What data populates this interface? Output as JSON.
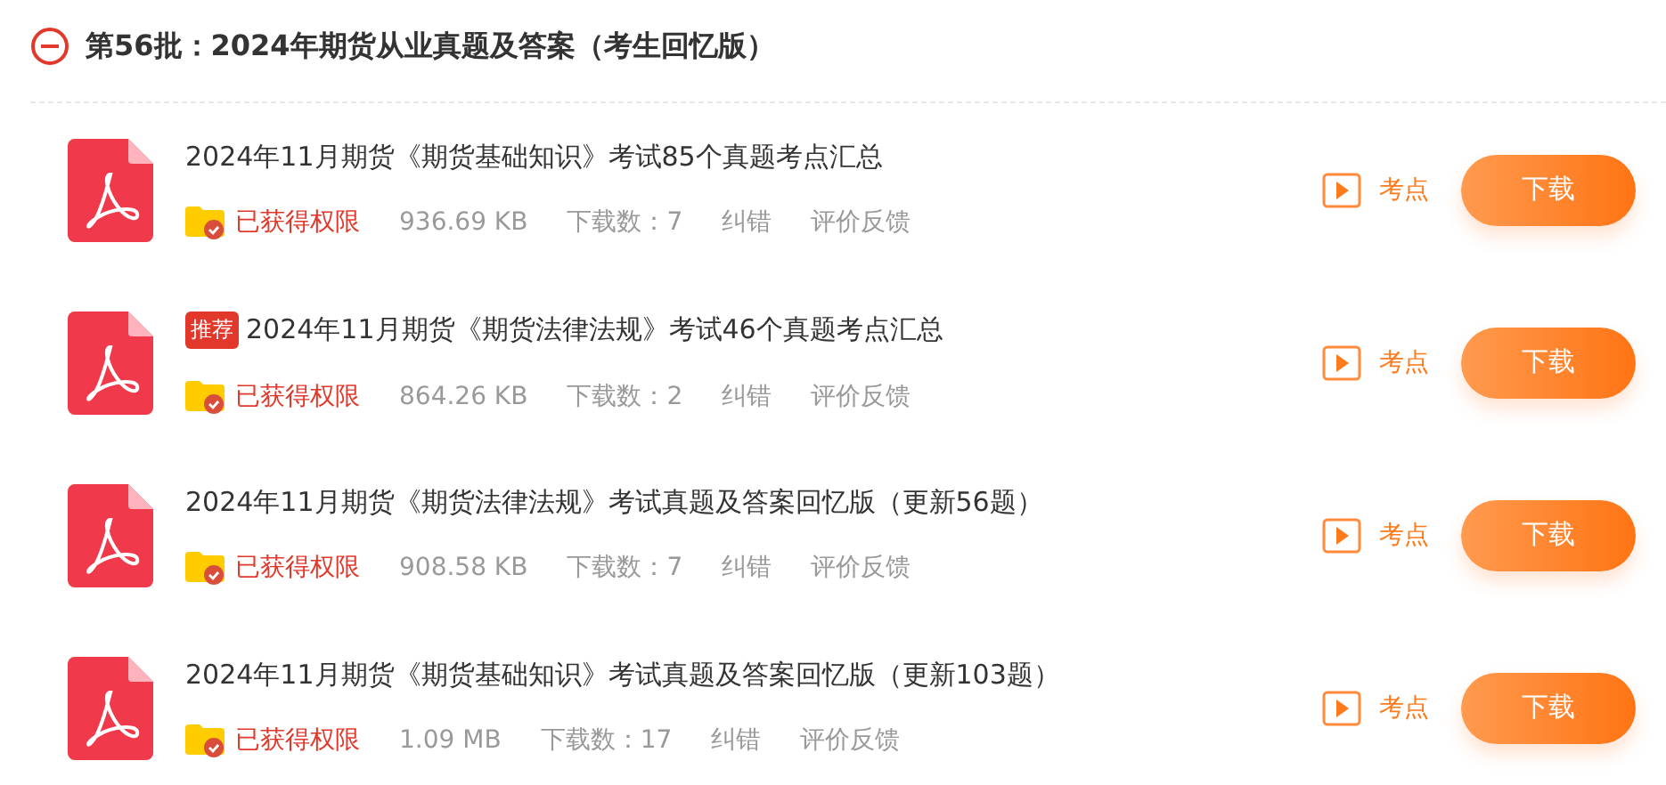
{
  "section": {
    "title": "第56批：2024年期货从业真题及答案（考生回忆版）",
    "expanded": true
  },
  "items": [
    {
      "title": "2024年11月期货《期货基础知识》考试85个真题考点汇总",
      "permission": "已获得权限",
      "size": "936.69 KB",
      "downloads": "下载数：7",
      "report": "纠错",
      "feedback": "评价反馈",
      "points": "考点",
      "download": "下载"
    },
    {
      "tag": "推荐",
      "title": "2024年11月期货《期货法律法规》考试46个真题考点汇总",
      "permission": "已获得权限",
      "size": "864.26 KB",
      "downloads": "下载数：2",
      "report": "纠错",
      "feedback": "评价反馈",
      "points": "考点",
      "download": "下载"
    },
    {
      "title": "2024年11月期货《期货法律法规》考试真题及答案回忆版（更新56题）",
      "permission": "已获得权限",
      "size": "908.58 KB",
      "downloads": "下载数：7",
      "report": "纠错",
      "feedback": "评价反馈",
      "points": "考点",
      "download": "下载"
    },
    {
      "title": "2024年11月期货《期货基础知识》考试真题及答案回忆版（更新103题）",
      "permission": "已获得权限",
      "size": "1.09 MB",
      "downloads": "下载数：17",
      "report": "纠错",
      "feedback": "评价反馈",
      "points": "考点",
      "download": "下载"
    }
  ]
}
